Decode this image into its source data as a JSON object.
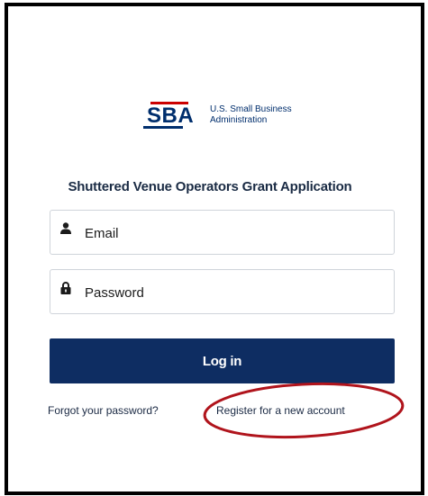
{
  "logo": {
    "mark": "SBA",
    "name_line1": "U.S. Small Business",
    "name_line2": "Administration"
  },
  "title": "Shuttered Venue Operators Grant Application",
  "email_field": {
    "placeholder": "Email",
    "icon": "user-icon"
  },
  "password_field": {
    "placeholder": "Password",
    "icon": "lock-icon"
  },
  "login_button": {
    "label": "Log in"
  },
  "links": {
    "forgot": "Forgot your password?",
    "register": "Register for a new account"
  },
  "colors": {
    "brand_navy": "#0e2d62",
    "brand_red": "#cc0000",
    "annotation": "#b0141c"
  },
  "annotation": {
    "type": "red-ellipse-highlight",
    "target": "register-link"
  }
}
